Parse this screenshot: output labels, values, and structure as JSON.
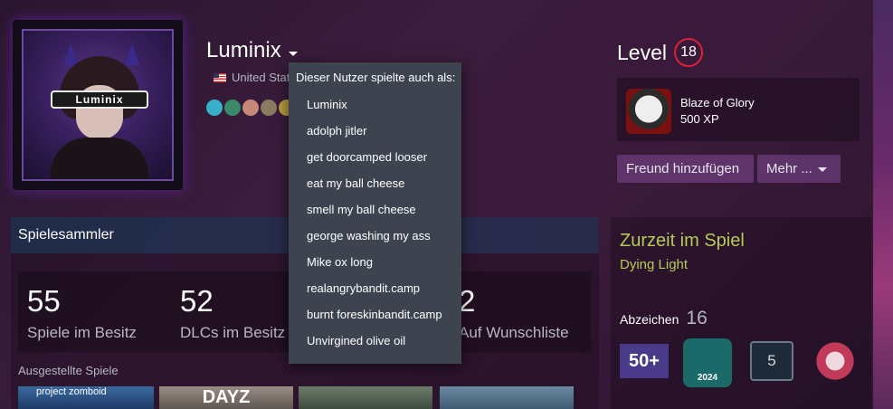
{
  "profile": {
    "username": "Luminix",
    "country": "United Stat",
    "avatar_text": "Luminix"
  },
  "alias_dropdown": {
    "header": "Dieser Nutzer spielte auch als:",
    "items": [
      "Luminix",
      "adolph jitler",
      "get doorcamped looser",
      "eat my ball cheese",
      "smell my ball cheese",
      "george washing my ass",
      "Mike ox long",
      "realangrybandit.camp",
      "burnt foreskinbandit.camp",
      "Unvirgined olive oil"
    ]
  },
  "level": {
    "label": "Level",
    "value": "18"
  },
  "featured_badge": {
    "name": "Blaze of Glory",
    "xp": "500 XP"
  },
  "actions": {
    "add_friend": "Freund hinzufügen",
    "more": "Mehr ..."
  },
  "showcase": {
    "title": "Spielesammler",
    "stats": [
      {
        "value": "55",
        "label": "Spiele im Besitz"
      },
      {
        "value": "52",
        "label": "DLCs im Besitz"
      },
      {
        "value": "2",
        "label": "Auf Wunschliste"
      }
    ],
    "featured_label": "Ausgestellte Spiele",
    "featured_games": [
      "project zomboid",
      "DAYZ",
      "",
      ""
    ]
  },
  "ingame": {
    "label": "Zurzeit im Spiel",
    "game": "Dying Light",
    "badges_label": "Abzeichen",
    "badges_count": "16",
    "badges": [
      {
        "icon": "50-plus-badge-icon",
        "text": "50+"
      },
      {
        "icon": "steam-2024-badge-icon",
        "text": "2024"
      },
      {
        "icon": "years-of-service-badge-icon",
        "text": "5"
      },
      {
        "icon": "winged-badge-icon",
        "text": ""
      }
    ]
  },
  "colors": {
    "level_ring": "#d8213b",
    "ingame_green": "#b6ca56",
    "dropdown_bg": "#3d4450"
  }
}
